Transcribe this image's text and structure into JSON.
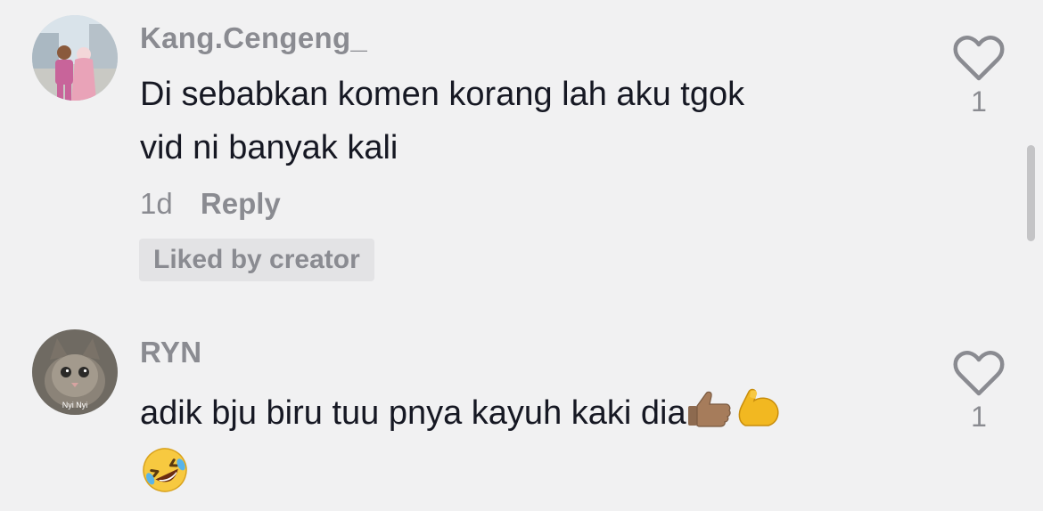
{
  "comments": [
    {
      "username": "Kang.Cengeng_",
      "text_line1": "Di sebabkan komen korang lah aku tgok",
      "text_line2": "vid ni banyak kali",
      "age": "1d",
      "reply_label": "Reply",
      "liked_badge": "Liked by creator",
      "like_count": "1",
      "avatar": "couple-photo-avatar"
    },
    {
      "username": "RYN",
      "text": "adik bju biru tuu pnya kayuh kaki dia",
      "emojis": [
        "thumbs-up",
        "flexed-biceps",
        "rolling-on-floor-laughing"
      ],
      "like_count": "1",
      "avatar": "kitten-photo-avatar",
      "avatar_caption": "Nyi Nyi"
    }
  ],
  "colors": {
    "background": "#f1f1f2",
    "primary_text": "#161823",
    "secondary_text": "#8a8b91",
    "badge_bg": "#e3e3e5"
  }
}
